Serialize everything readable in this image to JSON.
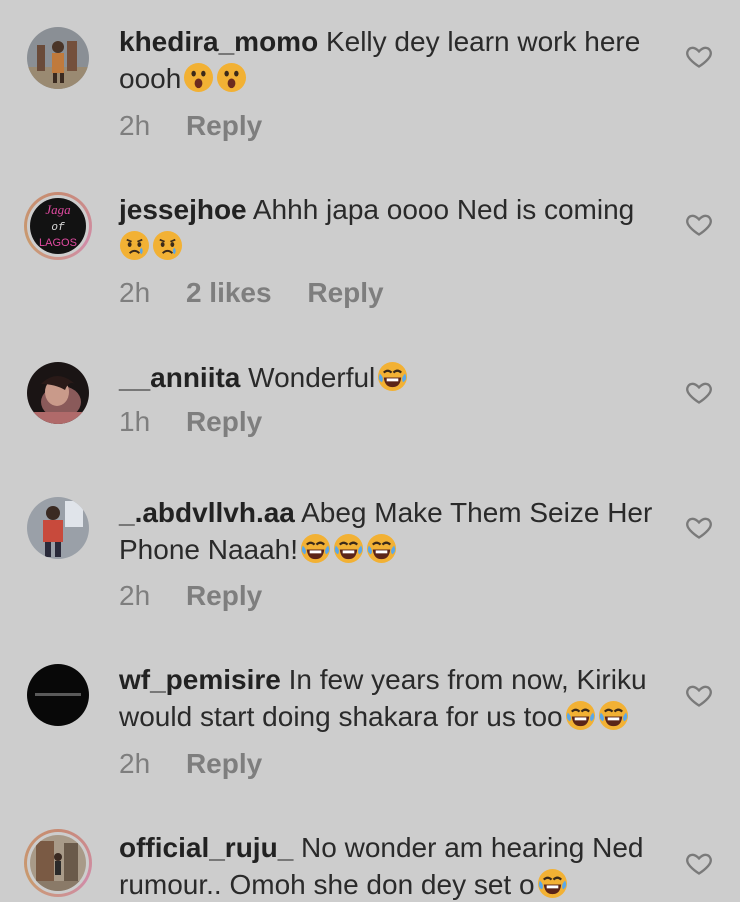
{
  "comments": [
    {
      "username": "khedira_momo",
      "text": "Kelly dey learn work here oooh",
      "emojis": [
        "astonished-face",
        "astonished-face"
      ],
      "time": "2h",
      "likes": "",
      "reply": "Reply"
    },
    {
      "username": "jessejhoe",
      "text": "Ahhh japa oooo Ned is coming",
      "avatar_text": [
        "Jaga",
        "of",
        "LAGOS"
      ],
      "emojis": [
        "sad-relieved-face",
        "sad-relieved-face"
      ],
      "time": "2h",
      "likes": "2 likes",
      "reply": "Reply"
    },
    {
      "username": "__anniita",
      "text": "Wonderful",
      "emojis": [
        "tears-of-joy-face"
      ],
      "time": "1h",
      "likes": "",
      "reply": "Reply"
    },
    {
      "username": "_.abdvllvh.aa",
      "text": "Abeg Make Them Seize Her Phone Naaah!",
      "emojis": [
        "tears-of-joy-face",
        "tears-of-joy-face",
        "tears-of-joy-face"
      ],
      "time": "2h",
      "likes": "",
      "reply": "Reply"
    },
    {
      "username": "wf_pemisire",
      "text": "In few years from now, Kiriku would start doing shakara for us too",
      "emojis": [
        "tears-of-joy-face",
        "tears-of-joy-face"
      ],
      "time": "2h",
      "likes": "",
      "reply": "Reply"
    },
    {
      "username": "official_ruju_",
      "text": "No wonder am hearing Ned rumour.. Omoh she don dey set o",
      "emojis": [
        "tears-of-joy-face"
      ],
      "time": "",
      "likes": "",
      "reply": ""
    }
  ],
  "colors": {
    "background": "#cdcdcd",
    "text": "#2a2a2a",
    "meta": "#7e7e7e",
    "emoji_face": "#f2b134"
  },
  "icons": {
    "like": "heart-outline-icon"
  }
}
